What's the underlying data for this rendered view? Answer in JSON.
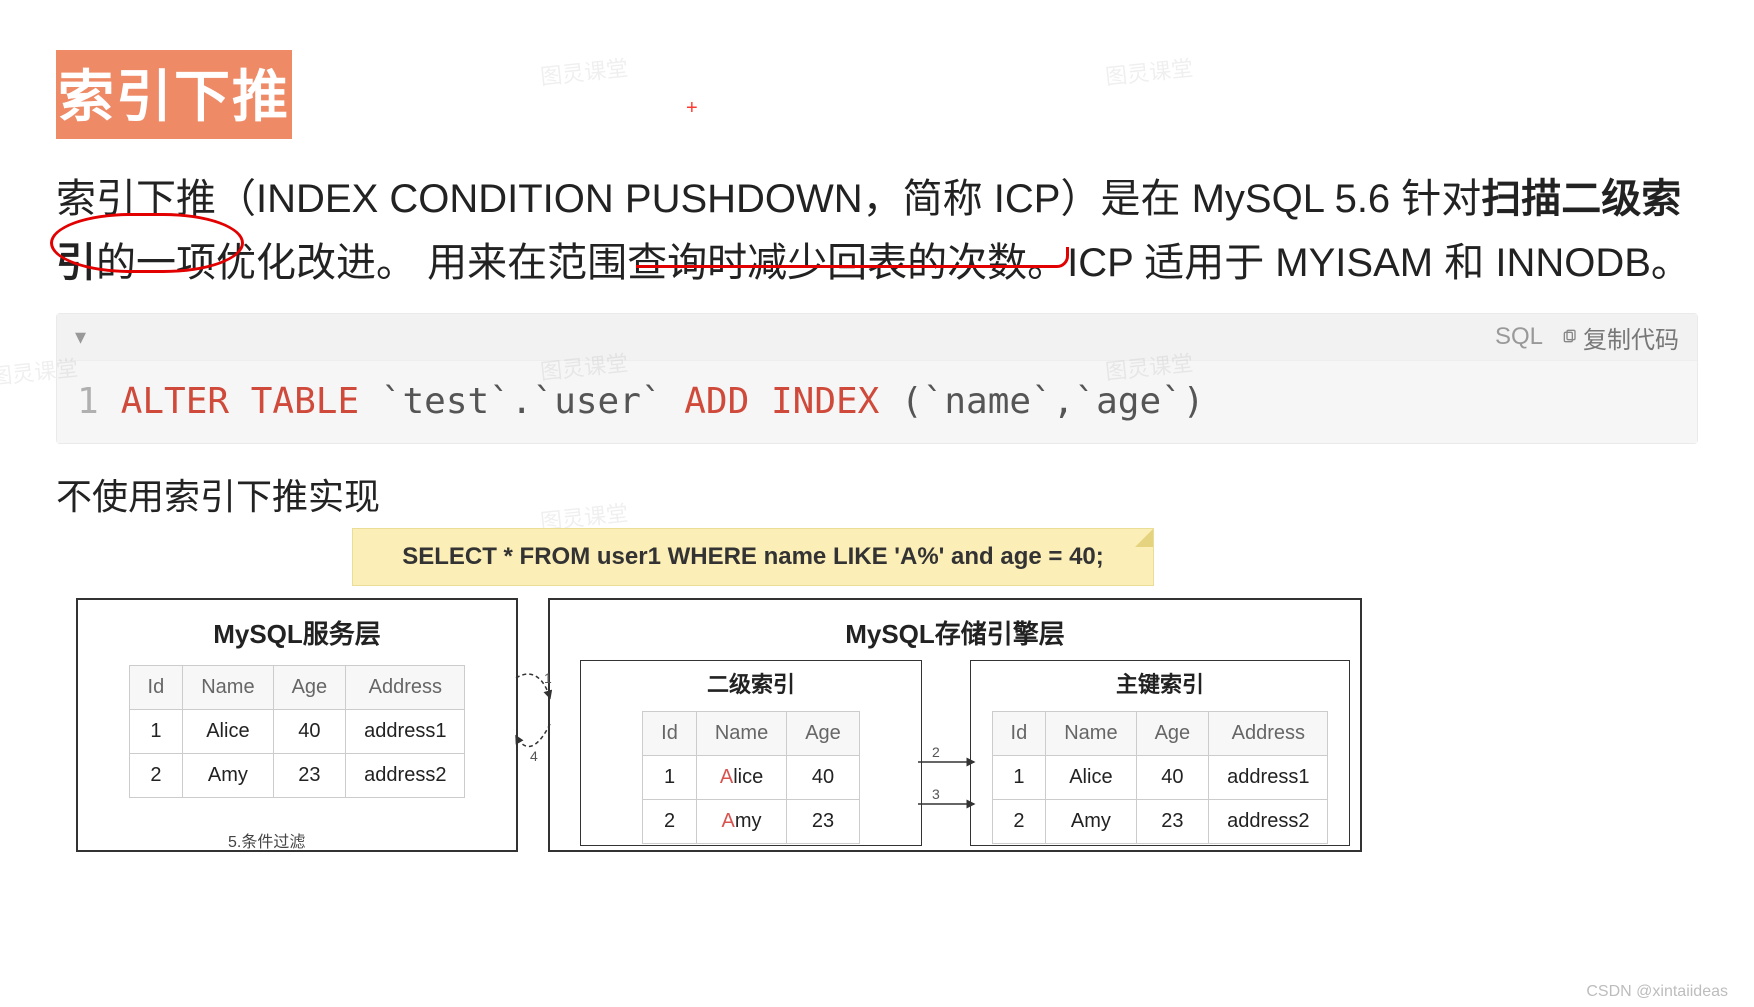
{
  "watermarks": [
    "图灵课堂",
    "图灵课堂",
    "图灵课堂",
    "图灵课堂",
    "图灵课堂",
    "图灵课堂"
  ],
  "title": "索引下推",
  "paragraph": {
    "p1a": "索引下推（INDEX CONDITION PUSHDOWN，简称 ICP）是在 MySQL 5.6 针对",
    "p1b": "扫描二级索引",
    "p1c": "的一项优化改进。 用来在",
    "p1d": "范围查询时减少回表的次数",
    "p1e": "。ICP 适用于 MYISAM 和 INNODB。"
  },
  "code": {
    "lang": "SQL",
    "copy_label": "复制代码",
    "line_no": "1",
    "kw1": "ALTER",
    "kw2": "TABLE",
    "mid": " `test`.`user`   ",
    "kw3": "ADD",
    "kw4": "INDEX",
    "tail": " (`name`,`age`)"
  },
  "subhead": "不使用索引下推实现",
  "sql_banner": "SELECT * FROM user1 WHERE name LIKE 'A%' and age = 40;",
  "left_box_title": "MySQL服务层",
  "right_box_title": "MySQL存储引擎层",
  "sec_idx_title": "二级索引",
  "pk_idx_title": "主键索引",
  "left_table": {
    "headers": [
      "Id",
      "Name",
      "Age",
      "Address"
    ],
    "rows": [
      [
        "1",
        "Alice",
        "40",
        "address1"
      ],
      [
        "2",
        "Amy",
        "23",
        "address2"
      ]
    ]
  },
  "sec_table": {
    "headers": [
      "Id",
      "Name",
      "Age"
    ],
    "rows": [
      [
        "1",
        "Alice",
        "40"
      ],
      [
        "2",
        "Amy",
        "23"
      ]
    ]
  },
  "pk_table": {
    "headers": [
      "Id",
      "Name",
      "Age",
      "Address"
    ],
    "rows": [
      [
        "1",
        "Alice",
        "40",
        "address1"
      ],
      [
        "2",
        "Amy",
        "23",
        "address2"
      ]
    ]
  },
  "filter_label": "5.条件过滤",
  "arrow_labels": {
    "a1": "1",
    "a4": "4",
    "a2": "2",
    "a3": "3"
  },
  "csdn": "CSDN @xintaiideas"
}
